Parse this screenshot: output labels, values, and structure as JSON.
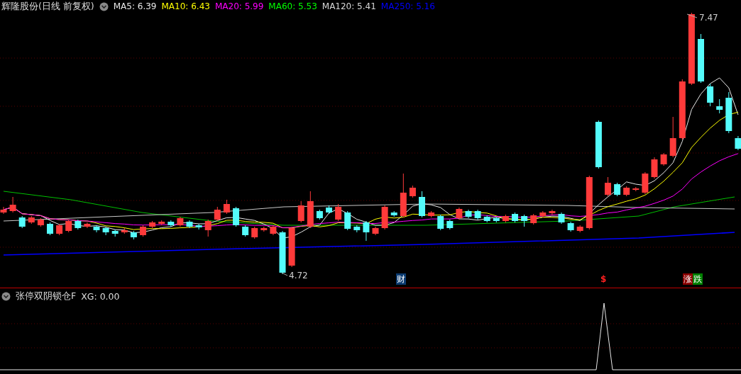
{
  "main_chart": {
    "title": "辉隆股份(日线 前复权)",
    "legend": [
      {
        "label": "MA5: 6.39",
        "color": "#e8e8e8"
      },
      {
        "label": "MA10: 6.43",
        "color": "#ffff00"
      },
      {
        "label": "MA20: 5.99",
        "color": "#ff00ff"
      },
      {
        "label": "MA60: 5.53",
        "color": "#00ff00"
      },
      {
        "label": "MA120: 5.41",
        "color": "#d8d8d8"
      },
      {
        "label": "MA250: 5.16",
        "color": "#0000ff"
      }
    ],
    "high_label": "7.47",
    "low_label": "4.72",
    "markers": [
      {
        "text": "财",
        "kind": "badge",
        "color": "#0a3a70"
      },
      {
        "text": "$",
        "kind": "symbol",
        "color": "#ff2020"
      },
      {
        "text": "涨",
        "kind": "badge",
        "color": "#8b0000"
      },
      {
        "text": "跌",
        "kind": "badge",
        "color": "#008000"
      }
    ]
  },
  "indicator": {
    "title": "张停双阴锁仓F",
    "value": "XG: 0.00"
  }
}
